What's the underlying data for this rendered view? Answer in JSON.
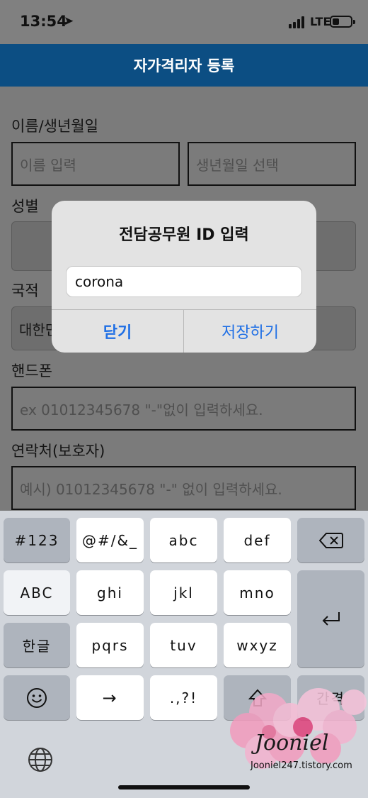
{
  "status_bar": {
    "time": "13:54",
    "network": "LTE"
  },
  "nav": {
    "title": "자가격리자 등록"
  },
  "form": {
    "name_label": "이름/생년월일",
    "name_placeholder": "이름 입력",
    "birth_placeholder": "생년월일 선택",
    "gender_label": "성별",
    "nationality_label": "국적",
    "nationality_value": "대한민",
    "phone_label": "핸드폰",
    "phone_placeholder": "ex 01012345678 \"-\"없이 입력하세요.",
    "guardian_label": "연락처(보호자)",
    "guardian_placeholder": "예시) 01012345678 \"-\" 없이 입력하세요."
  },
  "alert": {
    "title": "전담공무원 ID 입력",
    "input_value": "corona",
    "close_label": "닫기",
    "save_label": "저장하기"
  },
  "keyboard": {
    "row1": [
      "#123",
      "@#/&_",
      "abc",
      "def"
    ],
    "row2": [
      "ABC",
      "ghi",
      "jkl",
      "mno"
    ],
    "row3": [
      "한글",
      "pqrs",
      "tuv",
      "wxyz"
    ],
    "row4": [
      "→",
      ".,?!",
      "간격"
    ],
    "accent": "#1f6fe5"
  },
  "watermark": {
    "signature": "Jooniel",
    "url": "Jooniel247.tistory.com"
  }
}
